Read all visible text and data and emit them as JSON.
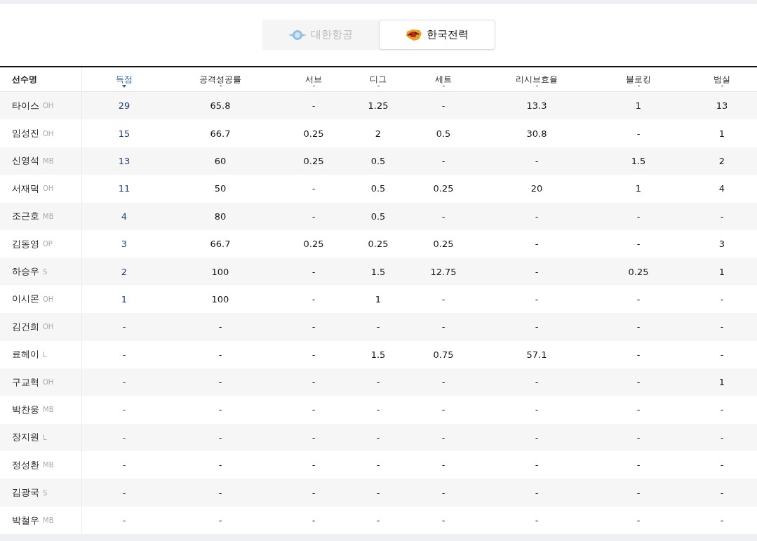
{
  "tabs": [
    {
      "label": "대한항공",
      "kind": "airline",
      "selected": false
    },
    {
      "label": "한국전력",
      "kind": "power",
      "selected": true
    }
  ],
  "table": {
    "columns": [
      {
        "label": "선수명",
        "sorted": false,
        "sortable": false
      },
      {
        "label": "득점",
        "sorted": true,
        "sortable": true
      },
      {
        "label": "공격성공률",
        "sorted": false,
        "sortable": true
      },
      {
        "label": "서브",
        "sorted": false,
        "sortable": true
      },
      {
        "label": "디그",
        "sorted": false,
        "sortable": true
      },
      {
        "label": "세트",
        "sorted": false,
        "sortable": true
      },
      {
        "label": "리시브효율",
        "sorted": false,
        "sortable": true
      },
      {
        "label": "블로킹",
        "sorted": false,
        "sortable": true
      },
      {
        "label": "범실",
        "sorted": false,
        "sortable": true
      }
    ],
    "rows": [
      {
        "name": "타이스",
        "position": "OH",
        "values": [
          "29",
          "65.8",
          "-",
          "1.25",
          "-",
          "13.3",
          "1",
          "13"
        ]
      },
      {
        "name": "임성진",
        "position": "OH",
        "values": [
          "15",
          "66.7",
          "0.25",
          "2",
          "0.5",
          "30.8",
          "-",
          "1"
        ]
      },
      {
        "name": "신영석",
        "position": "MB",
        "values": [
          "13",
          "60",
          "0.25",
          "0.5",
          "-",
          "-",
          "1.5",
          "2"
        ]
      },
      {
        "name": "서재덕",
        "position": "OH",
        "values": [
          "11",
          "50",
          "-",
          "0.5",
          "0.25",
          "20",
          "1",
          "4"
        ]
      },
      {
        "name": "조근호",
        "position": "MB",
        "values": [
          "4",
          "80",
          "-",
          "0.5",
          "-",
          "-",
          "-",
          "-"
        ]
      },
      {
        "name": "김동영",
        "position": "OP",
        "values": [
          "3",
          "66.7",
          "0.25",
          "0.25",
          "0.25",
          "-",
          "-",
          "3"
        ]
      },
      {
        "name": "하승우",
        "position": "S",
        "values": [
          "2",
          "100",
          "-",
          "1.5",
          "12.75",
          "-",
          "0.25",
          "1"
        ]
      },
      {
        "name": "이시몬",
        "position": "OH",
        "values": [
          "1",
          "100",
          "-",
          "1",
          "-",
          "-",
          "-",
          "-"
        ]
      },
      {
        "name": "김건희",
        "position": "OH",
        "values": [
          "-",
          "-",
          "-",
          "-",
          "-",
          "-",
          "-",
          "-"
        ]
      },
      {
        "name": "료헤이",
        "position": "L",
        "values": [
          "-",
          "-",
          "-",
          "1.5",
          "0.75",
          "57.1",
          "-",
          "-"
        ]
      },
      {
        "name": "구교혁",
        "position": "OH",
        "values": [
          "-",
          "-",
          "-",
          "-",
          "-",
          "-",
          "-",
          "1"
        ]
      },
      {
        "name": "박찬웅",
        "position": "MB",
        "values": [
          "-",
          "-",
          "-",
          "-",
          "-",
          "-",
          "-",
          "-"
        ]
      },
      {
        "name": "장지원",
        "position": "L",
        "values": [
          "-",
          "-",
          "-",
          "-",
          "-",
          "-",
          "-",
          "-"
        ]
      },
      {
        "name": "정성환",
        "position": "MB",
        "values": [
          "-",
          "-",
          "-",
          "-",
          "-",
          "-",
          "-",
          "-"
        ]
      },
      {
        "name": "김광국",
        "position": "S",
        "values": [
          "-",
          "-",
          "-",
          "-",
          "-",
          "-",
          "-",
          "-"
        ]
      },
      {
        "name": "박철우",
        "position": "MB",
        "values": [
          "-",
          "-",
          "-",
          "-",
          "-",
          "-",
          "-",
          "-"
        ]
      }
    ]
  }
}
